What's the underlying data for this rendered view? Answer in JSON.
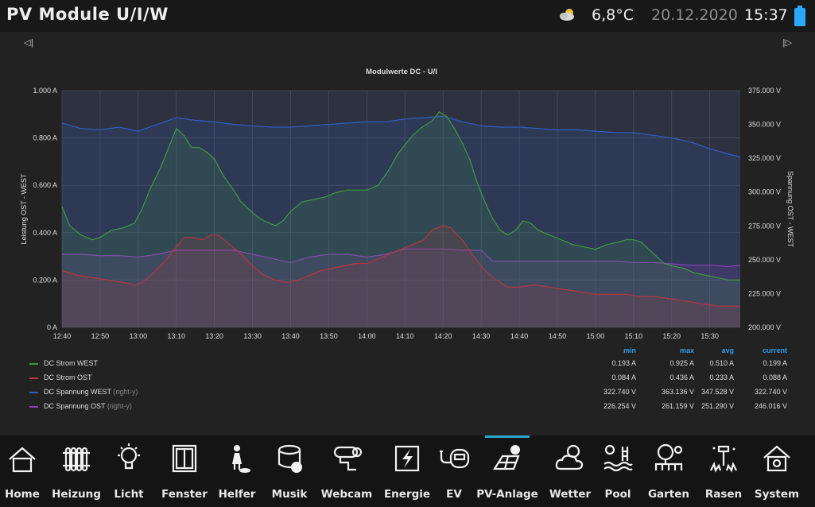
{
  "header": {
    "title": "PV Module U/I/W",
    "weather_icon": "partly-cloudy-icon",
    "temperature": "6,8°C",
    "date": "20.12.2020",
    "time": "15:37",
    "battery_icon": "battery-icon",
    "battery_color": "#2aa8ff"
  },
  "navigation": {
    "prev_icon": "step-back-icon",
    "next_icon": "step-forward-icon",
    "prev_label": "◁|",
    "next_label": "|▷"
  },
  "chart_data": {
    "type": "line",
    "title": "Modulwerte DC - U/I",
    "ylabel": "Leistung OST - WEST",
    "ylabel_right": "Spannung OST - WEST",
    "ylim": [
      0,
      1.0
    ],
    "ylim_right": [
      200,
      375
    ],
    "y_ticks": [
      "1.000 A",
      "0.800 A",
      "0.600 A",
      "0.400 A",
      "0.200 A",
      "0 A"
    ],
    "y_right_ticks": [
      "375.000 V",
      "350.000 V",
      "325.000 V",
      "300.000 V",
      "275.000 V",
      "250.000 V",
      "225.000 V",
      "200.000 V"
    ],
    "x_ticks": [
      "12:40",
      "12:50",
      "13:00",
      "13:10",
      "13:20",
      "13:30",
      "13:40",
      "13:50",
      "14:00",
      "14:10",
      "14:20",
      "14:30",
      "14:40",
      "14:50",
      "15:00",
      "15:10",
      "15:20",
      "15:30"
    ],
    "x_range": [
      "12:40",
      "15:38"
    ],
    "grid": true,
    "series": [
      {
        "name": "DC Strom WEST",
        "axis": "left",
        "color": "#3f9a3f",
        "points": [
          [
            "12:40",
            0.51
          ],
          [
            "12:42",
            0.43
          ],
          [
            "12:45",
            0.39
          ],
          [
            "12:48",
            0.37
          ],
          [
            "12:50",
            0.38
          ],
          [
            "12:53",
            0.41
          ],
          [
            "12:56",
            0.42
          ],
          [
            "12:59",
            0.44
          ],
          [
            "13:01",
            0.5
          ],
          [
            "13:03",
            0.58
          ],
          [
            "13:06",
            0.68
          ],
          [
            "13:08",
            0.76
          ],
          [
            "13:10",
            0.84
          ],
          [
            "13:12",
            0.81
          ],
          [
            "13:14",
            0.76
          ],
          [
            "13:16",
            0.76
          ],
          [
            "13:18",
            0.74
          ],
          [
            "13:20",
            0.71
          ],
          [
            "13:22",
            0.65
          ],
          [
            "13:25",
            0.58
          ],
          [
            "13:27",
            0.53
          ],
          [
            "13:29",
            0.5
          ],
          [
            "13:31",
            0.47
          ],
          [
            "13:33",
            0.45
          ],
          [
            "13:36",
            0.43
          ],
          [
            "13:38",
            0.45
          ],
          [
            "13:40",
            0.49
          ],
          [
            "13:43",
            0.53
          ],
          [
            "13:46",
            0.54
          ],
          [
            "13:49",
            0.55
          ],
          [
            "13:52",
            0.57
          ],
          [
            "13:55",
            0.58
          ],
          [
            "13:58",
            0.58
          ],
          [
            "14:00",
            0.58
          ],
          [
            "14:03",
            0.6
          ],
          [
            "14:06",
            0.67
          ],
          [
            "14:08",
            0.73
          ],
          [
            "14:10",
            0.77
          ],
          [
            "14:12",
            0.81
          ],
          [
            "14:14",
            0.84
          ],
          [
            "14:17",
            0.87
          ],
          [
            "14:19",
            0.91
          ],
          [
            "14:21",
            0.89
          ],
          [
            "14:23",
            0.84
          ],
          [
            "14:25",
            0.78
          ],
          [
            "14:27",
            0.71
          ],
          [
            "14:29",
            0.61
          ],
          [
            "14:31",
            0.53
          ],
          [
            "14:33",
            0.46
          ],
          [
            "14:35",
            0.41
          ],
          [
            "14:37",
            0.39
          ],
          [
            "14:39",
            0.41
          ],
          [
            "14:41",
            0.45
          ],
          [
            "14:43",
            0.44
          ],
          [
            "14:45",
            0.41
          ],
          [
            "14:48",
            0.39
          ],
          [
            "14:51",
            0.37
          ],
          [
            "14:54",
            0.35
          ],
          [
            "14:57",
            0.34
          ],
          [
            "15:00",
            0.33
          ],
          [
            "15:03",
            0.35
          ],
          [
            "15:06",
            0.36
          ],
          [
            "15:08",
            0.37
          ],
          [
            "15:10",
            0.37
          ],
          [
            "15:12",
            0.36
          ],
          [
            "15:14",
            0.33
          ],
          [
            "15:16",
            0.3
          ],
          [
            "15:18",
            0.27
          ],
          [
            "15:20",
            0.26
          ],
          [
            "15:23",
            0.25
          ],
          [
            "15:26",
            0.23
          ],
          [
            "15:29",
            0.22
          ],
          [
            "15:32",
            0.21
          ],
          [
            "15:35",
            0.2
          ],
          [
            "15:38",
            0.2
          ]
        ]
      },
      {
        "name": "DC Strom OST",
        "axis": "left",
        "color": "#b8343e",
        "points": [
          [
            "12:40",
            0.24
          ],
          [
            "12:44",
            0.22
          ],
          [
            "12:48",
            0.21
          ],
          [
            "12:52",
            0.2
          ],
          [
            "12:56",
            0.19
          ],
          [
            "12:59",
            0.18
          ],
          [
            "13:01",
            0.19
          ],
          [
            "13:04",
            0.23
          ],
          [
            "13:07",
            0.28
          ],
          [
            "13:10",
            0.34
          ],
          [
            "13:12",
            0.38
          ],
          [
            "13:14",
            0.38
          ],
          [
            "13:17",
            0.37
          ],
          [
            "13:19",
            0.39
          ],
          [
            "13:21",
            0.39
          ],
          [
            "13:24",
            0.35
          ],
          [
            "13:27",
            0.31
          ],
          [
            "13:30",
            0.26
          ],
          [
            "13:33",
            0.22
          ],
          [
            "13:36",
            0.2
          ],
          [
            "13:39",
            0.19
          ],
          [
            "13:42",
            0.2
          ],
          [
            "13:45",
            0.22
          ],
          [
            "13:48",
            0.24
          ],
          [
            "13:51",
            0.25
          ],
          [
            "13:54",
            0.26
          ],
          [
            "13:57",
            0.27
          ],
          [
            "14:00",
            0.27
          ],
          [
            "14:03",
            0.29
          ],
          [
            "14:06",
            0.31
          ],
          [
            "14:09",
            0.33
          ],
          [
            "14:12",
            0.35
          ],
          [
            "14:15",
            0.37
          ],
          [
            "14:17",
            0.41
          ],
          [
            "14:20",
            0.43
          ],
          [
            "14:22",
            0.42
          ],
          [
            "14:25",
            0.37
          ],
          [
            "14:28",
            0.3
          ],
          [
            "14:31",
            0.24
          ],
          [
            "14:34",
            0.2
          ],
          [
            "14:37",
            0.17
          ],
          [
            "14:40",
            0.17
          ],
          [
            "14:44",
            0.18
          ],
          [
            "14:48",
            0.17
          ],
          [
            "14:52",
            0.16
          ],
          [
            "14:56",
            0.15
          ],
          [
            "15:00",
            0.14
          ],
          [
            "15:04",
            0.14
          ],
          [
            "15:08",
            0.14
          ],
          [
            "15:12",
            0.13
          ],
          [
            "15:16",
            0.13
          ],
          [
            "15:20",
            0.12
          ],
          [
            "15:24",
            0.11
          ],
          [
            "15:28",
            0.1
          ],
          [
            "15:32",
            0.09
          ],
          [
            "15:36",
            0.09
          ],
          [
            "15:38",
            0.09
          ]
        ]
      },
      {
        "name": "DC Spannung WEST",
        "suffix": "(right-y)",
        "axis": "right",
        "color": "#2d5fc4",
        "points": [
          [
            "12:40",
            351
          ],
          [
            "12:45",
            347
          ],
          [
            "12:50",
            346
          ],
          [
            "12:55",
            348
          ],
          [
            "13:00",
            345
          ],
          [
            "13:05",
            350
          ],
          [
            "13:10",
            355
          ],
          [
            "13:15",
            353
          ],
          [
            "13:20",
            352
          ],
          [
            "13:25",
            350
          ],
          [
            "13:30",
            349
          ],
          [
            "13:35",
            348
          ],
          [
            "13:40",
            348
          ],
          [
            "13:45",
            349
          ],
          [
            "13:50",
            350
          ],
          [
            "13:55",
            351
          ],
          [
            "14:00",
            352
          ],
          [
            "14:05",
            352
          ],
          [
            "14:10",
            354
          ],
          [
            "14:15",
            355
          ],
          [
            "14:20",
            356
          ],
          [
            "14:25",
            352
          ],
          [
            "14:30",
            349
          ],
          [
            "14:35",
            348
          ],
          [
            "14:40",
            348
          ],
          [
            "14:45",
            347
          ],
          [
            "14:50",
            346
          ],
          [
            "14:55",
            346
          ],
          [
            "15:00",
            345
          ],
          [
            "15:05",
            344
          ],
          [
            "15:10",
            344
          ],
          [
            "15:15",
            342
          ],
          [
            "15:20",
            340
          ],
          [
            "15:25",
            337
          ],
          [
            "15:30",
            332
          ],
          [
            "15:35",
            328
          ],
          [
            "15:38",
            326
          ]
        ]
      },
      {
        "name": "DC Spannung OST",
        "suffix": "(right-y)",
        "axis": "right",
        "color": "#8c3fbf",
        "points": [
          [
            "12:40",
            254
          ],
          [
            "12:45",
            254
          ],
          [
            "12:50",
            253
          ],
          [
            "12:55",
            253
          ],
          [
            "13:00",
            252
          ],
          [
            "13:05",
            254
          ],
          [
            "13:10",
            257
          ],
          [
            "13:15",
            257
          ],
          [
            "13:20",
            257
          ],
          [
            "13:25",
            257
          ],
          [
            "13:30",
            254
          ],
          [
            "13:35",
            251
          ],
          [
            "13:40",
            248
          ],
          [
            "13:45",
            252
          ],
          [
            "13:50",
            254
          ],
          [
            "13:55",
            254
          ],
          [
            "14:00",
            252
          ],
          [
            "14:05",
            254
          ],
          [
            "14:10",
            258
          ],
          [
            "14:15",
            258
          ],
          [
            "14:20",
            258
          ],
          [
            "14:25",
            257
          ],
          [
            "14:30",
            257
          ],
          [
            "14:33",
            249
          ],
          [
            "14:40",
            249
          ],
          [
            "14:45",
            249
          ],
          [
            "14:50",
            249
          ],
          [
            "14:55",
            249
          ],
          [
            "15:00",
            249
          ],
          [
            "15:05",
            249
          ],
          [
            "15:10",
            248
          ],
          [
            "15:15",
            248
          ],
          [
            "15:20",
            247
          ],
          [
            "15:25",
            246
          ],
          [
            "15:30",
            246
          ],
          [
            "15:35",
            245
          ],
          [
            "15:38",
            246
          ]
        ]
      }
    ]
  },
  "legend": {
    "headers": [
      "min",
      "max",
      "avg",
      "current"
    ],
    "rows": [
      {
        "name": "DC Strom WEST",
        "suffix": "",
        "color": "#3f9a3f",
        "values": [
          "0.193 A",
          "0.925 A",
          "0.510 A",
          "0.199 A"
        ]
      },
      {
        "name": "DC Strom OST",
        "suffix": "",
        "color": "#b8343e",
        "values": [
          "0.084 A",
          "0.436 A",
          "0.233 A",
          "0.088 A"
        ]
      },
      {
        "name": "DC Spannung WEST",
        "suffix": "(right-y)",
        "color": "#2d5fc4",
        "values": [
          "322.740 V",
          "363.136 V",
          "347.528 V",
          "322.740 V"
        ]
      },
      {
        "name": "DC Spannung OST",
        "suffix": "(right-y)",
        "color": "#8c3fbf",
        "values": [
          "226.254 V",
          "261.159 V",
          "251.290 V",
          "246.016 V"
        ]
      }
    ]
  },
  "nav_bar": {
    "active_index": 9,
    "active_color": "#29a8c8",
    "items": [
      {
        "label": "Home",
        "icon": "house-icon"
      },
      {
        "label": "Heizung",
        "icon": "radiator-icon"
      },
      {
        "label": "Licht",
        "icon": "light-bulb-icon"
      },
      {
        "label": "Fenster",
        "icon": "window-icon"
      },
      {
        "label": "Helfer",
        "icon": "robot-vacuum-icon"
      },
      {
        "label": "Musik",
        "icon": "speaker-icon"
      },
      {
        "label": "Webcam",
        "icon": "security-camera-icon"
      },
      {
        "label": "Energie",
        "icon": "lightning-icon"
      },
      {
        "label": "EV",
        "icon": "electric-car-icon"
      },
      {
        "label": "PV-Anlage",
        "icon": "solar-panel-icon"
      },
      {
        "label": "Wetter",
        "icon": "weather-icon"
      },
      {
        "label": "Pool",
        "icon": "pool-icon"
      },
      {
        "label": "Garten",
        "icon": "garden-icon"
      },
      {
        "label": "Rasen",
        "icon": "sprinkler-icon"
      },
      {
        "label": "System",
        "icon": "system-house-icon"
      }
    ]
  }
}
